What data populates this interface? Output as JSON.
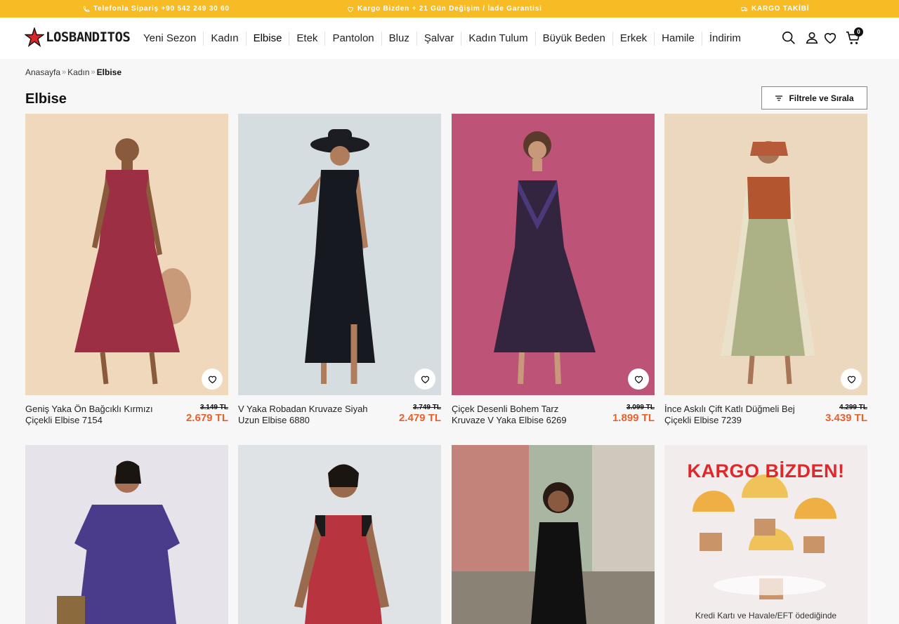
{
  "topbar": {
    "phone": "Telefonla Sipariş +90 542 249 30 60",
    "shipping": "Kargo Bizden + 21 Gün Değişim / İade Garantisi",
    "tracking": "KARGO TAKİBİ"
  },
  "header": {
    "logo_text": "LOSBANDITOS",
    "nav": [
      "Yeni Sezon",
      "Kadın",
      "Elbise",
      "Etek",
      "Pantolon",
      "Bluz",
      "Şalvar",
      "Kadın Tulum",
      "Büyük Beden",
      "Erkek",
      "Hamile",
      "İndirim"
    ],
    "cart_count": "0"
  },
  "breadcrumb": [
    "Anasayfa",
    "Kadın",
    "Elbise"
  ],
  "page_title": "Elbise",
  "filter_label": "Filtrele ve Sırala",
  "products": [
    {
      "name": "Geniş Yaka Ön Bağcıklı Kırmızı Çiçekli Elbise 7154",
      "old_price": "3.149 TL",
      "price": "2.679 TL"
    },
    {
      "name": "V Yaka Robadan Kruvaze Siyah Uzun Elbise 6880",
      "old_price": "3.749 TL",
      "price": "2.479 TL"
    },
    {
      "name": "Çiçek Desenli Bohem Tarz Kruvaze V Yaka Elbise 6269",
      "old_price": "3.099 TL",
      "price": "1.899 TL"
    },
    {
      "name": "İnce Askılı Çift Katlı Düğmeli Bej Çiçekli Elbise 7239",
      "old_price": "4.299 TL",
      "price": "3.439 TL"
    }
  ],
  "banner": {
    "title": "KARGO BİZDEN!",
    "text": "Kredi Kartı ve Havale/EFT ödediğinde"
  },
  "colors": {
    "topbar": "#f7bb25",
    "price": "#e8612a",
    "banner_title": "#e0272a"
  }
}
